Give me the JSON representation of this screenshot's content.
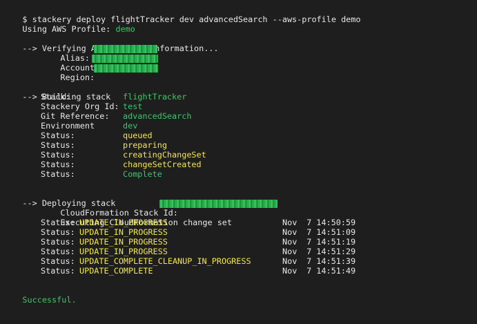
{
  "terminal": {
    "command": "$ stackery deploy flightTracker dev advancedSearch --aws-profile demo",
    "profile_label": "Using AWS Profile: ",
    "profile_value": "demo",
    "verify_header": "--> Verifying AWS account information...",
    "alias_label": "Alias:",
    "account_label": "AccountId:",
    "region_label": "Region:",
    "build_header": "--> Building stack",
    "stack_label": "Stack:",
    "stack_value": "flightTracker",
    "org_label": "Stackery Org Id:",
    "org_value": "test",
    "gitref_label": "Git Reference:",
    "gitref_value": "advancedSearch",
    "env_label": "Environment",
    "env_value": "dev",
    "status_label": "Status:",
    "build_statuses": [
      "queued",
      "preparing",
      "creatingChangeSet",
      "changeSetCreated",
      "Complete"
    ],
    "deploy_header": "--> Deploying stack",
    "cf_stack_label": "CloudFormation Stack Id:",
    "executing": "Executing CloudFormation change set",
    "deploy_statuses": [
      {
        "label": "Status: ",
        "value": "UPDATE_IN_PROGRESS",
        "month": "Nov",
        "time": " 7 14:50:59"
      },
      {
        "label": "Status: ",
        "value": "UPDATE_IN_PROGRESS",
        "month": "Nov",
        "time": " 7 14:51:09"
      },
      {
        "label": "Status: ",
        "value": "UPDATE_IN_PROGRESS",
        "month": "Nov",
        "time": " 7 14:51:19"
      },
      {
        "label": "Status: ",
        "value": "UPDATE_IN_PROGRESS",
        "month": "Nov",
        "time": " 7 14:51:29"
      },
      {
        "label": "Status: ",
        "value": "UPDATE_COMPLETE_CLEANUP_IN_PROGRESS",
        "month": "Nov",
        "time": " 7 14:51:39"
      },
      {
        "label": "Status: ",
        "value": "UPDATE_COMPLETE",
        "month": "Nov",
        "time": " 7 14:51:49"
      }
    ],
    "result": "Successful."
  },
  "colors": {
    "background": "#1e1e1e",
    "text": "#e8e8e8",
    "green": "#3fc46a",
    "yellow": "#f2e64a"
  }
}
